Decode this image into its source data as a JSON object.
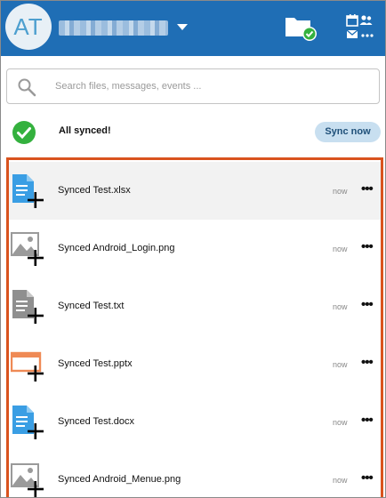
{
  "header": {
    "avatar_initials": "AT",
    "account_name_blurred": "",
    "colors": {
      "bar": "#1f6eb5",
      "avatar_bg": "#e8f0f6",
      "avatar_text": "#4d9fcf"
    },
    "icons": {
      "folder": "folder-synced-icon",
      "apps": "calendar-contacts-mail-icon"
    }
  },
  "search": {
    "placeholder": "Search files, messages, events ...",
    "value": ""
  },
  "status": {
    "text": "All synced!",
    "button_label": "Sync now",
    "icon": "check-circle-icon",
    "colors": {
      "check": "#34b13e",
      "button_bg": "#c8dff0"
    }
  },
  "files": [
    {
      "name": "Synced Test.xlsx",
      "time": "now",
      "icon": "document-add-icon",
      "color": "#3a9ee4"
    },
    {
      "name": "Synced Android_Login.png",
      "time": "now",
      "icon": "image-add-icon",
      "color": "#9a9a9a"
    },
    {
      "name": "Synced Test.txt",
      "time": "now",
      "icon": "document-add-icon",
      "color": "#8f8f8f"
    },
    {
      "name": "Synced Test.pptx",
      "time": "now",
      "icon": "presentation-add-icon",
      "color": "#ef8a55"
    },
    {
      "name": "Synced Test.docx",
      "time": "now",
      "icon": "document-add-icon",
      "color": "#3a9ee4"
    },
    {
      "name": "Synced Android_Menue.png",
      "time": "now",
      "icon": "image-add-icon",
      "color": "#9a9a9a"
    }
  ],
  "list_highlight_border": "#d9531e",
  "more_glyph": "•••"
}
